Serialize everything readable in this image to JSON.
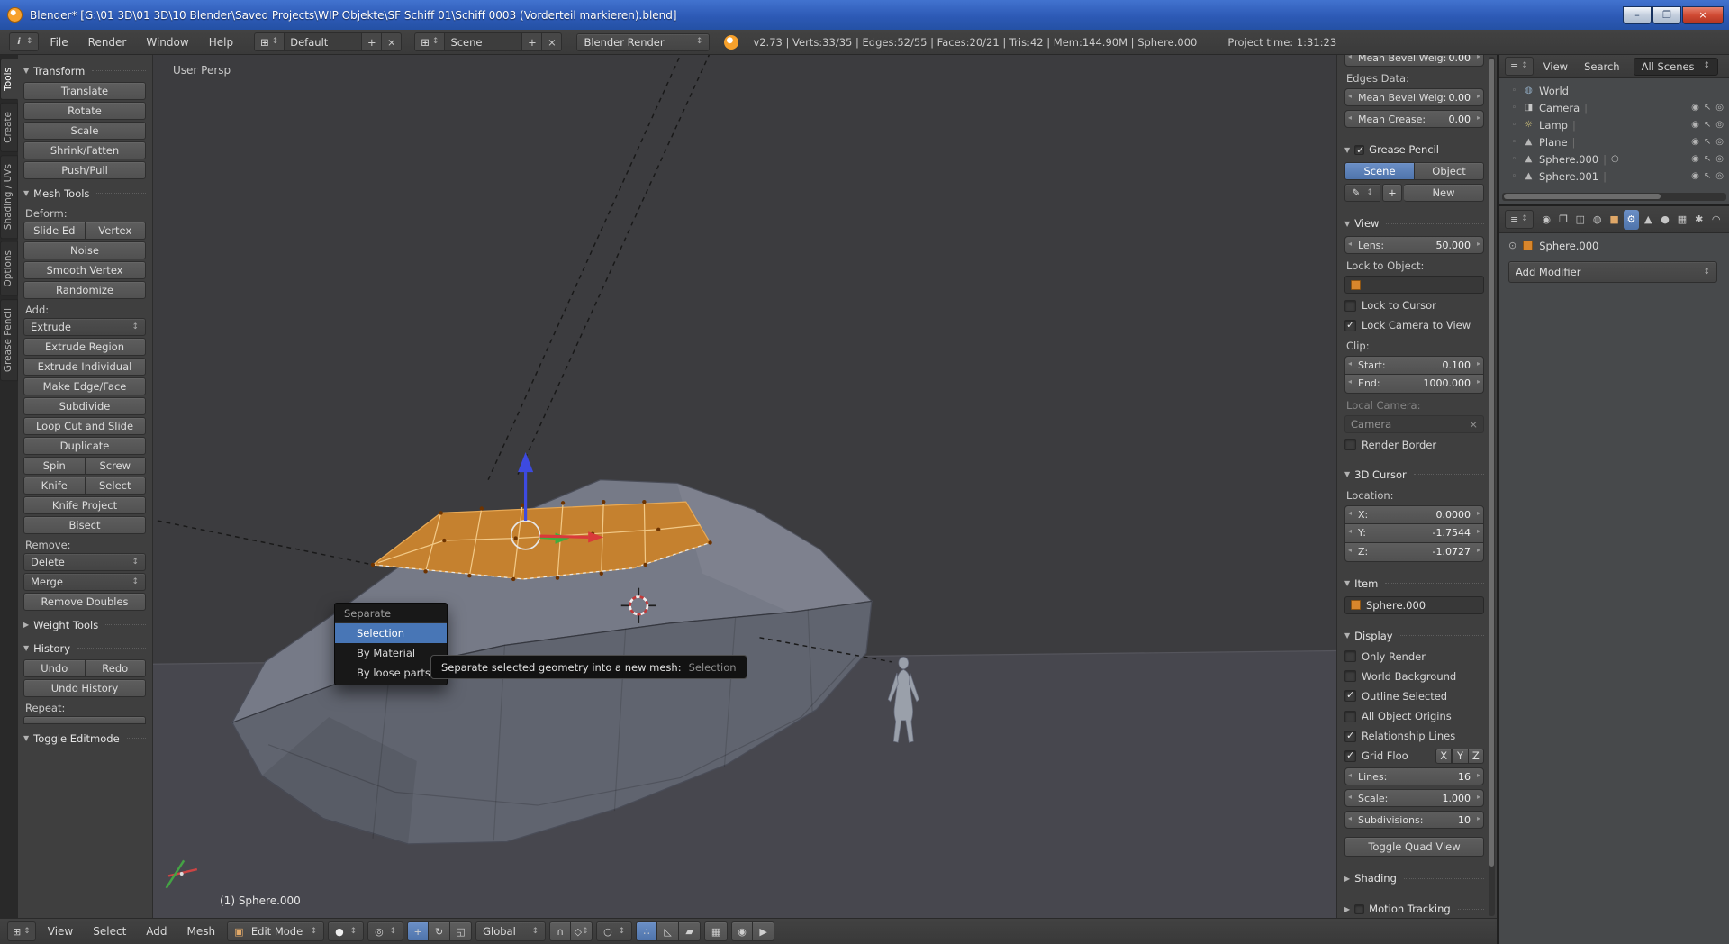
{
  "window": {
    "title": "Blender* [G:\\01 3D\\01 3D\\10 Blender\\Saved Projects\\WIP Objekte\\SF Schiff 01\\Schiff 0003 (Vorderteil markieren).blend]",
    "buttons": {
      "minimize": "–",
      "maximize": "❐",
      "close": "×"
    }
  },
  "icons": {
    "updown": "↕",
    "grid": "⊞",
    "plus": "+",
    "close": "×",
    "pencil": "✎",
    "cube": "▣",
    "sphere": "●",
    "pivot": "◎",
    "translate": "+",
    "rotate": "↻",
    "scale": "◱",
    "magnet": "∩",
    "snap_elem": "◇",
    "proportional": "○",
    "vertex_mode": "∴",
    "edge_mode": "◺",
    "face_mode": "▰",
    "occlude": "▦",
    "render_still": "◉",
    "render_anim": "▶",
    "eye": "◉",
    "cursor": "↖",
    "camera": "◎",
    "editor": "≡"
  },
  "info_bar": {
    "menus": [
      "File",
      "Render",
      "Window",
      "Help"
    ],
    "layout_value": "Default",
    "scene_value": "Scene",
    "engine_value": "Blender Render",
    "stats": "v2.73 | Verts:33/35 | Edges:52/55 | Faces:20/21 | Tris:42 | Mem:144.90M | Sphere.000",
    "project_time": "Project time: 1:31:23"
  },
  "tool_tabs": [
    "Tools",
    "Create",
    "Shading / UVs",
    "Options",
    "Grease Pencil"
  ],
  "tools": {
    "transform_title": "Transform",
    "transform_buttons": [
      "Translate",
      "Rotate",
      "Scale",
      "Shrink/Fatten",
      "Push/Pull"
    ],
    "mesh_title": "Mesh Tools",
    "deform_label": "Deform:",
    "slide_edge": "Slide Ed",
    "vertex": "Vertex",
    "deform_buttons": [
      "Noise",
      "Smooth Vertex",
      "Randomize"
    ],
    "add_label": "Add:",
    "extrude": "Extrude",
    "add_buttons": [
      "Extrude Region",
      "Extrude Individual",
      "Make Edge/Face",
      "Subdivide",
      "Loop Cut and Slide",
      "Duplicate"
    ],
    "spin": "Spin",
    "screw": "Screw",
    "knife": "Knife",
    "select": "Select",
    "knife_project": "Knife Project",
    "bisect": "Bisect",
    "remove_label": "Remove:",
    "delete": "Delete",
    "merge": "Merge",
    "remove_doubles": "Remove Doubles",
    "weight_title": "Weight Tools",
    "history_title": "History",
    "undo": "Undo",
    "redo": "Redo",
    "undo_history": "Undo History",
    "repeat_label": "Repeat:",
    "last_op_title": "Toggle Editmode"
  },
  "viewport": {
    "view_label": "User Persp",
    "status_label": "(1) Sphere.000",
    "menu": {
      "title": "Separate",
      "items": [
        "Selection",
        "By Material",
        "By loose parts"
      ]
    },
    "tooltip": {
      "text": "Separate selected geometry into a new mesh:",
      "hint": "Selection"
    }
  },
  "view3d_header": {
    "menus": [
      "View",
      "Select",
      "Add",
      "Mesh"
    ],
    "mode": "Edit Mode",
    "orientation": "Global"
  },
  "sidebar": {
    "clipped_field": {
      "label": "Mean Bevel Weig:",
      "value": "0.00"
    },
    "edges_label": "Edges Data:",
    "mean_bevel": {
      "label": "Mean Bevel Weig:",
      "value": "0.00"
    },
    "mean_crease": {
      "label": "Mean Crease:",
      "value": "0.00"
    },
    "gp_title": "Grease Pencil",
    "gp_scene": "Scene",
    "gp_object": "Object",
    "gp_new": "New",
    "view_title": "View",
    "lens": {
      "label": "Lens:",
      "value": "50.000"
    },
    "lock_obj_label": "Lock to Object:",
    "lock_cursor": {
      "label": "Lock to Cursor",
      "checked": false
    },
    "lock_cam": {
      "label": "Lock Camera to View",
      "checked": true
    },
    "clip_label": "Clip:",
    "clip_start": {
      "label": "Start:",
      "value": "0.100"
    },
    "clip_end": {
      "label": "End:",
      "value": "1000.000"
    },
    "local_cam_label": "Local Camera:",
    "local_cam_value": "Camera",
    "render_border": {
      "label": "Render Border",
      "checked": false
    },
    "cursor_title": "3D Cursor",
    "location_label": "Location:",
    "loc_x": {
      "label": "X:",
      "value": "0.0000"
    },
    "loc_y": {
      "label": "Y:",
      "value": "-1.7544"
    },
    "loc_z": {
      "label": "Z:",
      "value": "-1.0727"
    },
    "item_title": "Item",
    "item_name": "Sphere.000",
    "display_title": "Display",
    "d_only_render": {
      "label": "Only Render",
      "checked": false
    },
    "d_world_bg": {
      "label": "World Background",
      "checked": false
    },
    "d_outline": {
      "label": "Outline Selected",
      "checked": true
    },
    "d_origins": {
      "label": "All Object Origins",
      "checked": false
    },
    "d_rel_lines": {
      "label": "Relationship Lines",
      "checked": true
    },
    "d_grid": {
      "label": "Grid Floo",
      "checked": true
    },
    "axis_x": "X",
    "axis_y": "Y",
    "axis_z": "Z",
    "lines": {
      "label": "Lines:",
      "value": "16"
    },
    "scale": {
      "label": "Scale:",
      "value": "1.000"
    },
    "subdiv": {
      "label": "Subdivisions:",
      "value": "10"
    },
    "quad_view": "Toggle Quad View",
    "shading_title": "Shading",
    "motion_title": "Motion Tracking"
  },
  "outliner": {
    "menus": [
      "View",
      "Search"
    ],
    "scope": "All Scenes",
    "rows": [
      {
        "name": "World",
        "glyph": "◍"
      },
      {
        "name": "Camera",
        "glyph": "◨"
      },
      {
        "name": "Lamp",
        "glyph": "☼"
      },
      {
        "name": "Plane",
        "glyph": "▲"
      },
      {
        "name": "Sphere.000",
        "glyph": "▲",
        "extra": "○"
      },
      {
        "name": "Sphere.001",
        "glyph": "▲"
      }
    ]
  },
  "prop_tabs": [
    {
      "name": "render",
      "glyph": "◉"
    },
    {
      "name": "render-layers",
      "glyph": "❐"
    },
    {
      "name": "scene",
      "glyph": "◫"
    },
    {
      "name": "world",
      "glyph": "◍"
    },
    {
      "name": "object",
      "glyph": "■"
    },
    {
      "name": "modifiers",
      "glyph": "⚙"
    },
    {
      "name": "data",
      "glyph": "▲"
    },
    {
      "name": "material",
      "glyph": "●"
    },
    {
      "name": "texture",
      "glyph": "▦"
    },
    {
      "name": "particles",
      "glyph": "✱"
    },
    {
      "name": "physics",
      "glyph": "◠"
    }
  ],
  "properties": {
    "pointer": "Sphere.000",
    "add_modifier": "Add Modifier"
  }
}
